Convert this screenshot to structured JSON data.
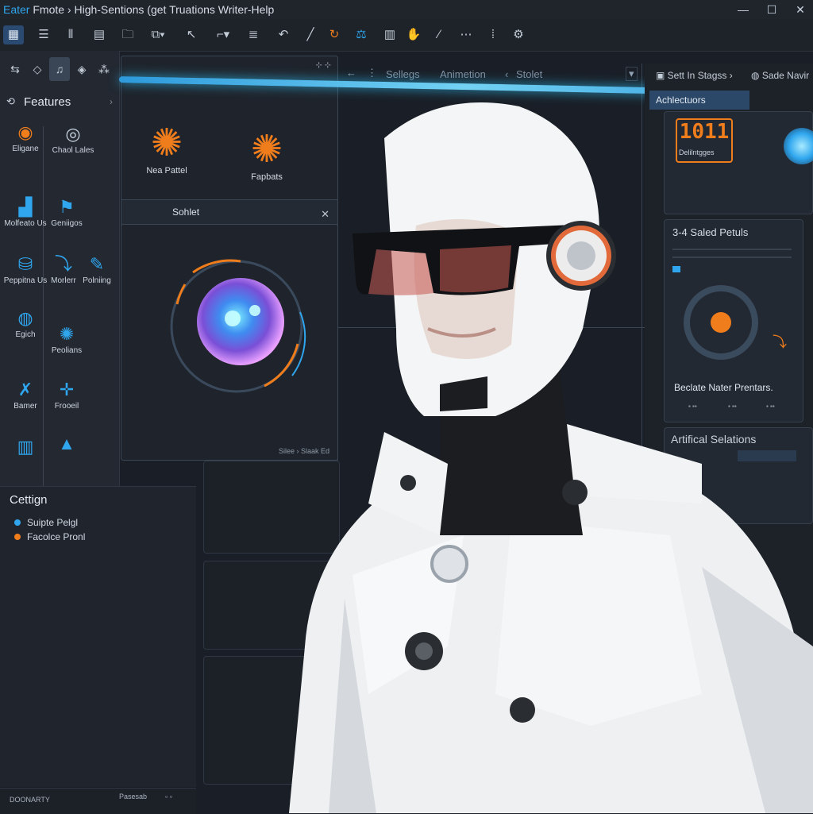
{
  "window": {
    "title_accent": "Eater",
    "title_rest": " Fmote › High-Sentions (get Truations Writer-Help",
    "controls": [
      "—",
      "☐",
      "✕"
    ]
  },
  "toolbar": {
    "buttons": [
      "grid-icon",
      "menu-icon",
      "columns-icon",
      "book-icon",
      "folder-icon",
      "copy-icon",
      "cursor-icon",
      "crop-icon",
      "list-icon",
      "undo-icon",
      "pen-icon",
      "refresh-icon",
      "scale-icon",
      "film-icon",
      "hand-icon",
      "brush-icon",
      "more-icon",
      "divider-icon",
      "settings-icon"
    ]
  },
  "left_panel": {
    "tabs": [
      "arrows-icon",
      "diamond-icon",
      "music-icon",
      "tag-icon",
      "nodes-icon"
    ],
    "header": {
      "label": "Features"
    },
    "features": [
      {
        "label": "Eligane",
        "icon": "bulb-icon"
      },
      {
        "label": "Chaol Lales",
        "icon": "head-icon"
      },
      {
        "label": "Molfeato Us",
        "icon": "chart-icon"
      },
      {
        "label": "Geniigos",
        "icon": "flag-icon"
      },
      {
        "label": "Peppitna Us",
        "icon": "database-icon"
      },
      {
        "label": "Morlerr",
        "icon": "arrow-icon"
      },
      {
        "label": "Polniing",
        "icon": "feather-icon"
      },
      {
        "label": "Egich",
        "icon": "search-icon"
      },
      {
        "label": "Peolians",
        "icon": "gear-icon"
      },
      {
        "label": "Bamer",
        "icon": "tools-icon"
      },
      {
        "label": "Frooeil",
        "icon": "move-icon"
      }
    ]
  },
  "legend": {
    "title": "Cettign",
    "items": [
      {
        "label": "Suipte Pelgl",
        "color": "#2fa6ee"
      },
      {
        "label": "Facolce Pronl",
        "color": "#f07d1c"
      }
    ]
  },
  "statusbar": {
    "left": "DOONARTY",
    "right": "Pasesab"
  },
  "card1": {
    "items": [
      {
        "label": "Nea Pattel"
      },
      {
        "label": "Fapbats"
      }
    ],
    "footer": "Sohlet"
  },
  "card2": {
    "footer": "Silee › Slaak Ed"
  },
  "nav": {
    "items": [
      "Sellegs",
      "Animetion",
      "Stolet"
    ]
  },
  "right_panel": {
    "top_tabs": [
      "Sett In Stagss",
      "Sade Navir"
    ],
    "section": "Achlectuors",
    "counter": "1011",
    "counter_sub": "Delilntgges",
    "card_title": "3-4 Saled Petuls",
    "card_caption": "Beclate Nater Prentars.",
    "card_actions": [
      "▪ ▪▪",
      "▪ ▪▪",
      "▪ ▪▪"
    ],
    "bottom_title": "Artifical Selations"
  },
  "colors": {
    "accent_blue": "#2fa6ee",
    "accent_orange": "#f07d1c",
    "bg": "#1a1f27"
  }
}
